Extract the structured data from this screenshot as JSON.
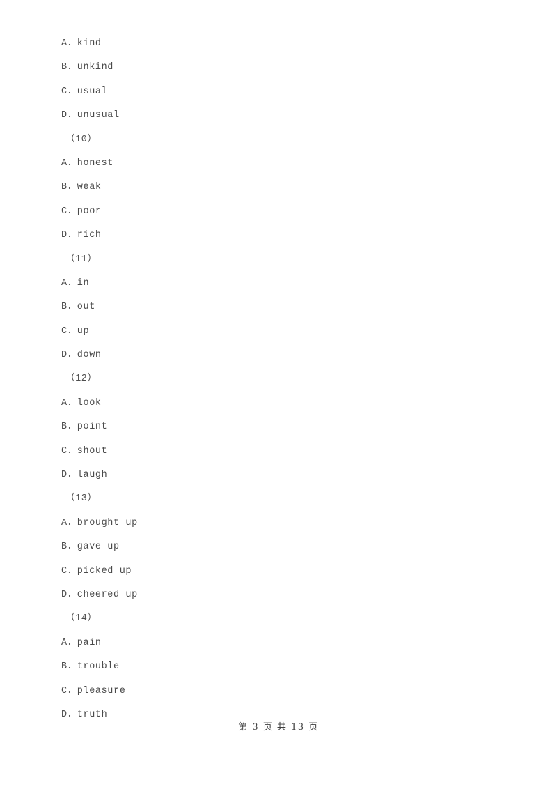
{
  "document": {
    "page_background": "#ffffff",
    "text_color": "#4a4a4a",
    "lines": [
      {
        "kind": "option",
        "text": "A．kind"
      },
      {
        "kind": "option",
        "text": "B．unkind"
      },
      {
        "kind": "option",
        "text": "C．usual"
      },
      {
        "kind": "option",
        "text": "D．unusual"
      },
      {
        "kind": "qnum",
        "text": "（10）"
      },
      {
        "kind": "option",
        "text": "A．honest"
      },
      {
        "kind": "option",
        "text": "B．weak"
      },
      {
        "kind": "option",
        "text": "C．poor"
      },
      {
        "kind": "option",
        "text": "D．rich"
      },
      {
        "kind": "qnum",
        "text": "（11）"
      },
      {
        "kind": "option",
        "text": "A．in"
      },
      {
        "kind": "option",
        "text": "B．out"
      },
      {
        "kind": "option",
        "text": "C．up"
      },
      {
        "kind": "option",
        "text": "D．down"
      },
      {
        "kind": "qnum",
        "text": "（12）"
      },
      {
        "kind": "option",
        "text": "A．look"
      },
      {
        "kind": "option",
        "text": "B．point"
      },
      {
        "kind": "option",
        "text": "C．shout"
      },
      {
        "kind": "option",
        "text": "D．laugh"
      },
      {
        "kind": "qnum",
        "text": "（13）"
      },
      {
        "kind": "option",
        "text": "A．brought up"
      },
      {
        "kind": "option",
        "text": "B．gave up"
      },
      {
        "kind": "option",
        "text": "C．picked up"
      },
      {
        "kind": "option",
        "text": "D．cheered up"
      },
      {
        "kind": "qnum",
        "text": "（14）"
      },
      {
        "kind": "option",
        "text": "A．pain"
      },
      {
        "kind": "option",
        "text": "B．trouble"
      },
      {
        "kind": "option",
        "text": "C．pleasure"
      },
      {
        "kind": "option",
        "text": "D．truth"
      }
    ]
  },
  "footer": {
    "text": "第 3 页 共 13 页",
    "current_page": "3",
    "total_pages": "13"
  }
}
